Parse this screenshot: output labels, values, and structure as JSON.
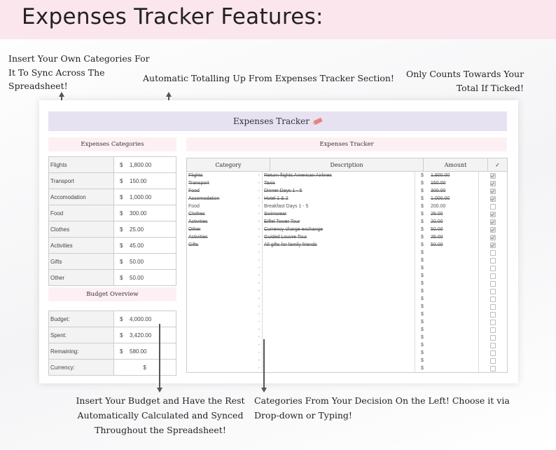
{
  "banner": {
    "title": "Expenses Tracker Features:"
  },
  "notes": {
    "categories": [
      "Insert Your Own Categories For",
      "It To Sync Across The",
      "Spreadsheet!"
    ],
    "totalling": [
      "Automatic Totalling Up From Expenses Tracker Section!"
    ],
    "ticked": [
      "Only Counts Towards Your",
      "Total If Ticked!"
    ],
    "budget": [
      "Insert Your Budget and Have the Rest",
      "Automatically Calculated and Synced",
      "Throughout the Spreadsheet!"
    ],
    "dropdown": [
      "Categories From Your Decision On the Left! Choose it via",
      "Drop-down or Typing!"
    ]
  },
  "sheet": {
    "title": "Expenses Tracker",
    "categories_title": "Expenses Categories",
    "categories": [
      {
        "name": "Flights",
        "currency": "$",
        "value": "1,800.00"
      },
      {
        "name": "Transport",
        "currency": "$",
        "value": "150.00"
      },
      {
        "name": "Accomodation",
        "currency": "$",
        "value": "1,000.00"
      },
      {
        "name": "Food",
        "currency": "$",
        "value": "300.00"
      },
      {
        "name": "Clothes",
        "currency": "$",
        "value": "25.00"
      },
      {
        "name": "Activities",
        "currency": "$",
        "value": "45.00"
      },
      {
        "name": "Gifts",
        "currency": "$",
        "value": "50.00"
      },
      {
        "name": "Other",
        "currency": "$",
        "value": "50.00"
      }
    ],
    "budget_title": "Budget Overview",
    "budget": [
      {
        "name": "Budget:",
        "currency": "$",
        "value": "4,000.00"
      },
      {
        "name": "Spent:",
        "currency": "$",
        "value": "3,420.00"
      },
      {
        "name": "Remaining:",
        "currency": "$",
        "value": "580.00"
      },
      {
        "name": "Currency:",
        "currency": "",
        "value": "$"
      }
    ],
    "tracker_title": "Expenses Tracker",
    "tracker_headers": [
      "Category",
      "Description",
      "Amount",
      "✓"
    ],
    "dash": "-",
    "dollar": "$",
    "entries": [
      {
        "category": "Flights",
        "description": "Return flights American Airlines",
        "amount": "1,800.00",
        "ticked": true
      },
      {
        "category": "Transport",
        "description": "Taxis",
        "amount": "150.00",
        "ticked": true
      },
      {
        "category": "Food",
        "description": "Dinner Days 1 - 5",
        "amount": "300.00",
        "ticked": true
      },
      {
        "category": "Accomodation",
        "description": "Hotel 1 & 2",
        "amount": "1,000.00",
        "ticked": true
      },
      {
        "category": "Food",
        "description": "Breakfast Days 1 - 5",
        "amount": "200.00",
        "ticked": false
      },
      {
        "category": "Clothes",
        "description": "Swimwear",
        "amount": "25.00",
        "ticked": true
      },
      {
        "category": "Activities",
        "description": "Eiffel Tower Tour",
        "amount": "20.00",
        "ticked": true
      },
      {
        "category": "Other",
        "description": "Currency charge exchange",
        "amount": "50.00",
        "ticked": true
      },
      {
        "category": "Activities",
        "description": "Guided Louvre Tour",
        "amount": "25.00",
        "ticked": true
      },
      {
        "category": "Gifts",
        "description": "All gifts for family friends",
        "amount": "50.00",
        "ticked": true
      }
    ],
    "empty_rows": 16
  }
}
